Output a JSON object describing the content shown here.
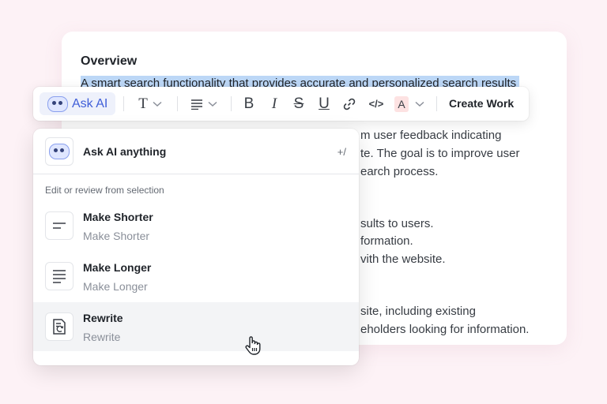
{
  "document": {
    "heading": "Overview",
    "highlighted_text": "A smart search functionality that provides accurate and personalized search results",
    "lines": [
      "m user feedback indicating",
      "te. The goal is to improve user",
      "earch process.",
      "sults to users.",
      "formation.",
      "vith the website.",
      "site, including existing",
      "eholders looking for information."
    ]
  },
  "toolbar": {
    "ask_ai_label": "Ask AI",
    "create_work_label": "Create Work",
    "icons": [
      "robot-icon",
      "text-style-icon",
      "chevron-down-icon",
      "align-icon",
      "chevron-down-icon",
      "bold-icon",
      "italic-icon",
      "strikethrough-icon",
      "underline-icon",
      "link-icon",
      "code-icon",
      "font-color-icon",
      "chevron-down-icon"
    ],
    "text_style_glyph": "T",
    "bold_glyph": "B",
    "italic_glyph": "I",
    "strike_glyph": "S",
    "underline_glyph": "U",
    "code_glyph": "</>",
    "font_color_glyph": "A",
    "font_color_swatch": "#fde2e2"
  },
  "ai_menu": {
    "ask_label": "Ask AI anything",
    "ask_shortcut": "+/",
    "section_label": "Edit or review from selection",
    "items": [
      {
        "title": "Make Shorter",
        "subtitle": "Make Shorter",
        "icon": "short-lines-icon"
      },
      {
        "title": "Make Longer",
        "subtitle": "Make Longer",
        "icon": "long-lines-icon"
      },
      {
        "title": "Rewrite",
        "subtitle": "Rewrite",
        "icon": "rewrite-icon"
      }
    ],
    "active_index": 2
  },
  "colors": {
    "accent": "#3f5ed8",
    "highlight": "#bcd7f6",
    "background": "#fdf2f6"
  }
}
